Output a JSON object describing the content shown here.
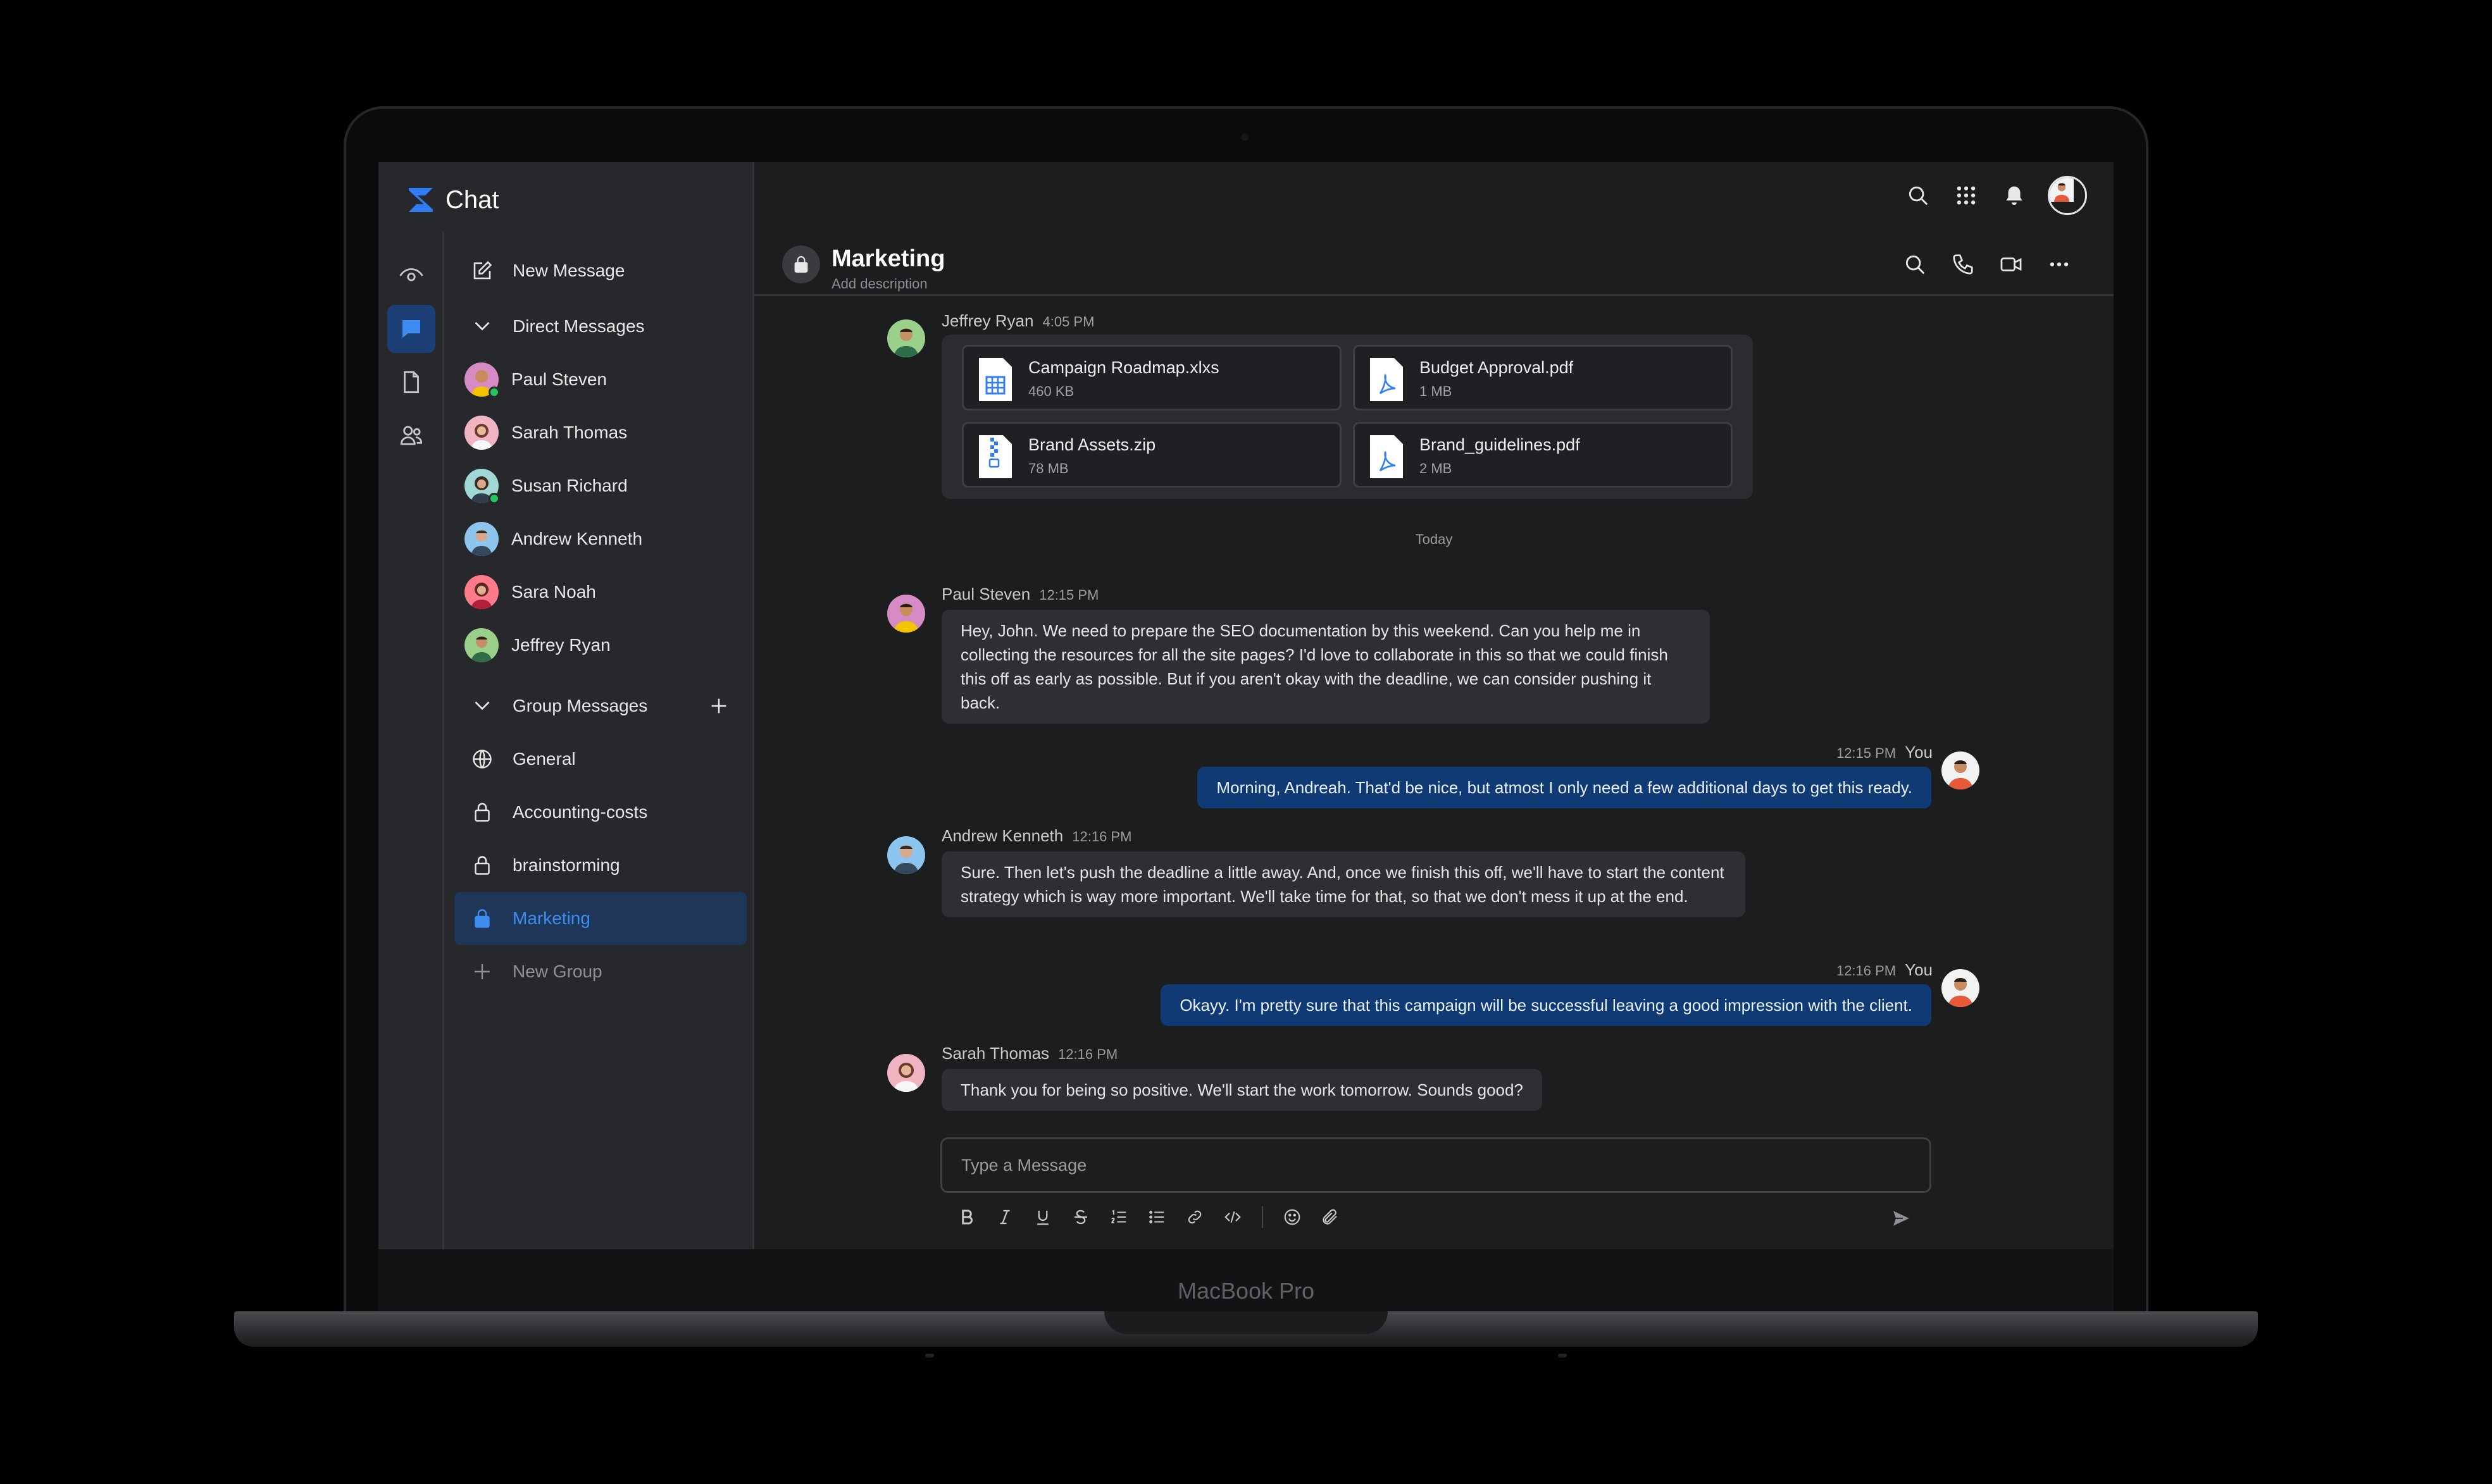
{
  "device": {
    "label": "MacBook Pro"
  },
  "app": {
    "name": "Chat",
    "accent": "#2f7cf6"
  },
  "sidebar": {
    "new_message": "New Message",
    "direct_header": "Direct Messages",
    "direct": [
      {
        "name": "Paul Steven",
        "online": true
      },
      {
        "name": "Sarah Thomas",
        "online": false
      },
      {
        "name": "Susan Richard",
        "online": true
      },
      {
        "name": "Andrew Kenneth",
        "online": false
      },
      {
        "name": "Sara Noah",
        "online": false
      },
      {
        "name": "Jeffrey Ryan",
        "online": false
      }
    ],
    "group_header": "Group Messages",
    "groups": [
      {
        "name": "General",
        "icon": "globe-icon"
      },
      {
        "name": "Accounting-costs",
        "icon": "lock-icon"
      },
      {
        "name": "brainstorming",
        "icon": "lock-icon"
      },
      {
        "name": "Marketing",
        "icon": "lock-icon",
        "active": true
      }
    ],
    "new_group": "New Group"
  },
  "channel": {
    "title": "Marketing",
    "description": "Add description"
  },
  "messages": {
    "m1": {
      "author": "Jeffrey Ryan",
      "time": "4:05 PM",
      "files": [
        {
          "name": "Campaign Roadmap.xlxs",
          "size": "460 KB",
          "type": "spreadsheet"
        },
        {
          "name": "Budget Approval.pdf",
          "size": "1 MB",
          "type": "pdf"
        },
        {
          "name": "Brand Assets.zip",
          "size": "78 MB",
          "type": "zip"
        },
        {
          "name": "Brand_guidelines.pdf",
          "size": "2 MB",
          "type": "pdf"
        }
      ]
    },
    "day_separator": "Today",
    "m2": {
      "author": "Paul Steven",
      "time": "12:15 PM",
      "text": "Hey, John. We need to prepare the SEO documentation by this weekend. Can you help me in collecting the resources for all the site pages? I'd love to collaborate in this so that we could finish this off as early as possible. But if you aren't okay with the deadline, we can consider pushing it back."
    },
    "m3": {
      "author": "You",
      "time": "12:15 PM",
      "text": "Morning, Andreah. That'd be nice, but atmost I only need a few additional days to get this ready."
    },
    "m4": {
      "author": "Andrew Kenneth",
      "time": "12:16 PM",
      "text": "Sure. Then let's push the deadline a little away. And, once we finish this off, we'll have to start the content strategy which is way more important. We'll take time for that, so that we don't mess it up at the end."
    },
    "m5": {
      "author": "You",
      "time": "12:16 PM",
      "text": "Okayy. I'm pretty sure that this campaign will be successful leaving a good impression with the client."
    },
    "m6": {
      "author": "Sarah Thomas",
      "time": "12:16 PM",
      "text": "Thank you for being so positive. We'll start the work tomorrow. Sounds good?"
    }
  },
  "composer": {
    "placeholder": "Type a Message"
  }
}
